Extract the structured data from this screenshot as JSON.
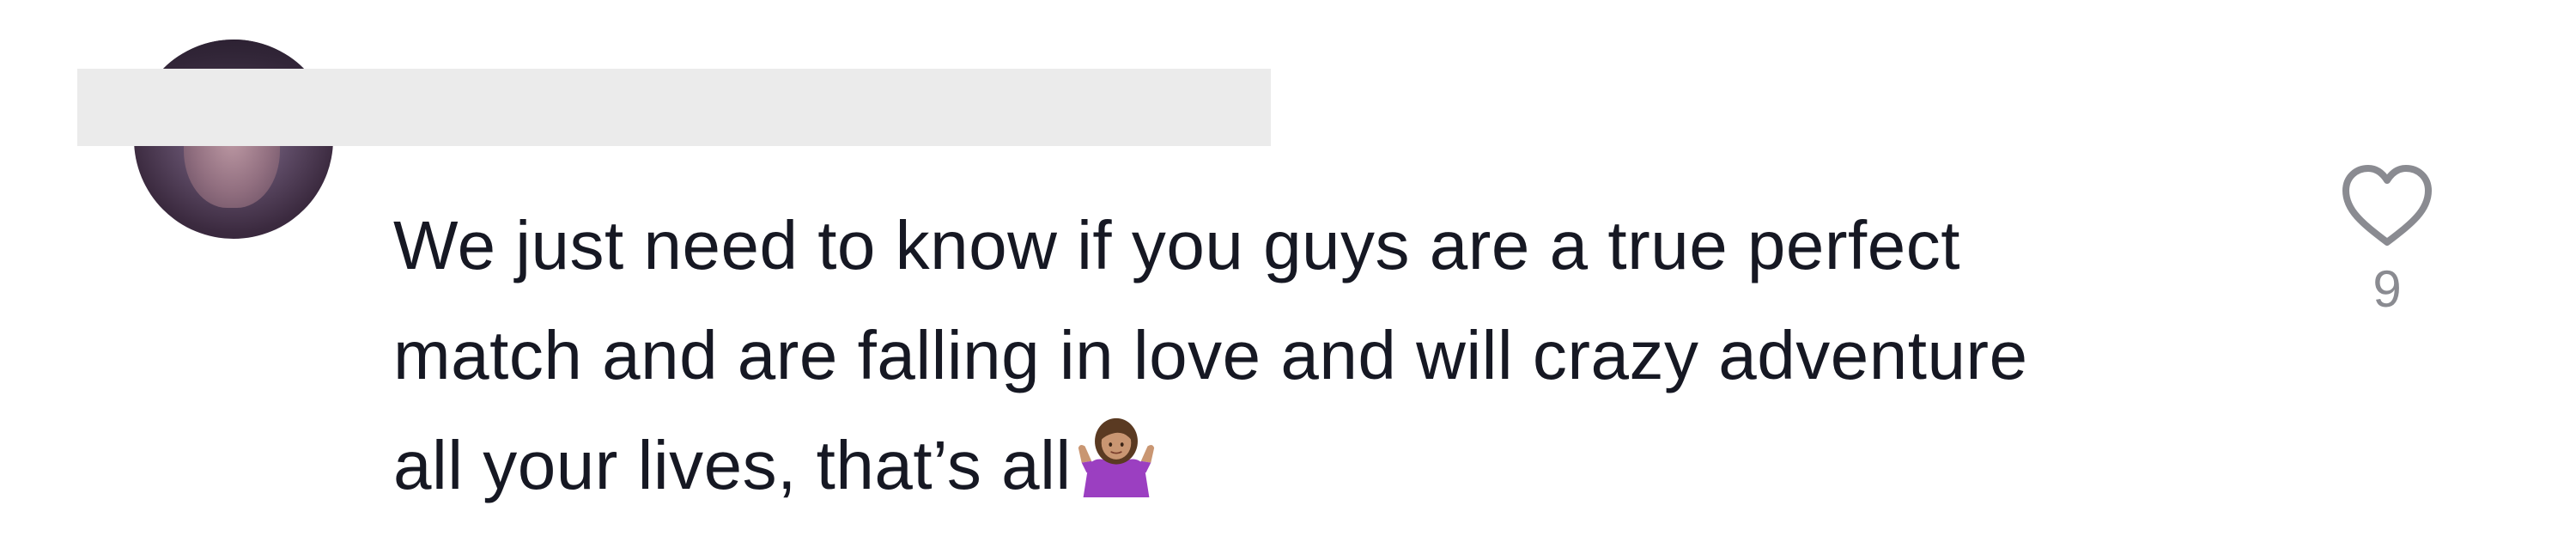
{
  "comment": {
    "author": {
      "avatar_icon": "user-avatar",
      "name_redacted": true
    },
    "text_lines": [
      "We just need to know if you guys are a true perfect",
      "match and are falling in love and will crazy adventure",
      "all your lives, that’s all"
    ],
    "emoji_icon": "person-shrugging-emoji",
    "like": {
      "icon": "heart-outline-icon",
      "count": "9",
      "color": "#8a8b91"
    }
  },
  "colors": {
    "text": "#161823",
    "redaction": "#ebebeb",
    "emoji_shirt": "#9b3fc1"
  }
}
